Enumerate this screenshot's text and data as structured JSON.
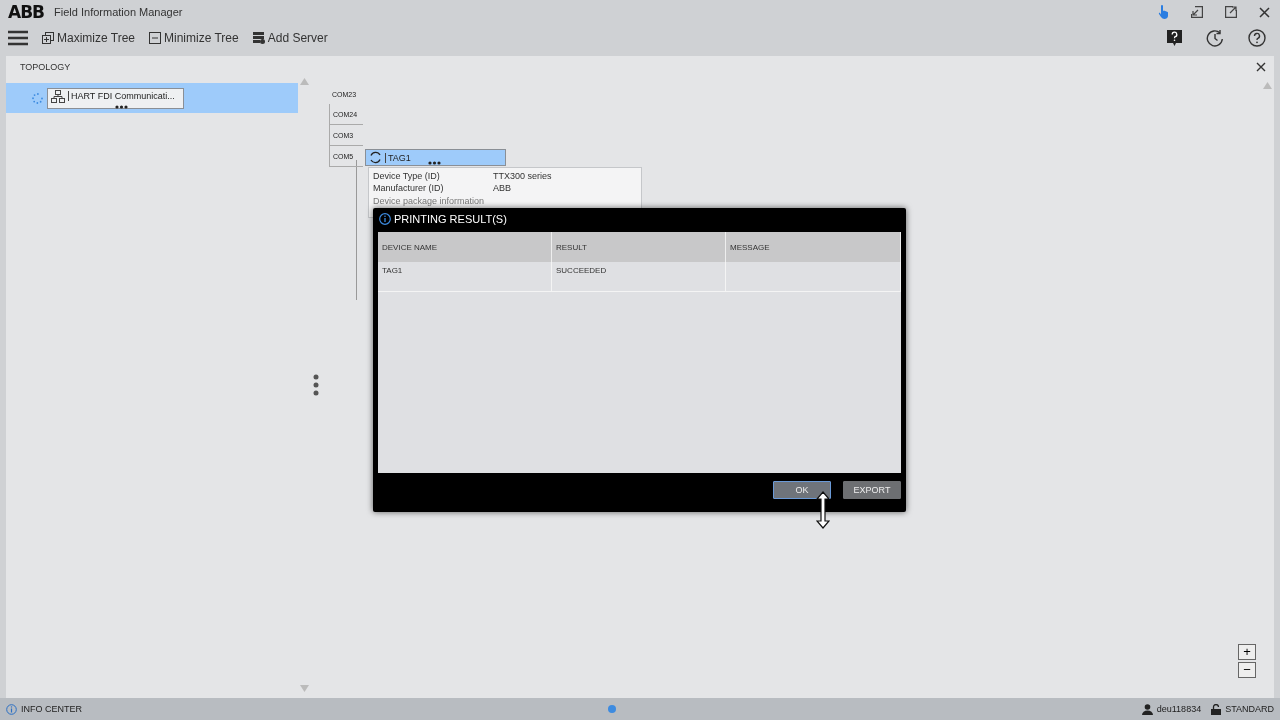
{
  "window": {
    "logo": "ABB",
    "title": "Field Information Manager"
  },
  "toolbar": [
    {
      "label": "Maximize Tree",
      "kind": "maximize"
    },
    {
      "label": "Minimize Tree",
      "kind": "minimize"
    },
    {
      "label": "Add Server",
      "kind": "server"
    }
  ],
  "panel": {
    "title": "TOPOLOGY"
  },
  "tree": [
    {
      "label": "HART FDI Communicati...",
      "selected": true
    }
  ],
  "ports": [
    "COM23",
    "COM24",
    "COM3",
    "COM5"
  ],
  "device": {
    "tag": "TAG1",
    "selected": true,
    "properties": [
      {
        "label": "Device Type (ID)",
        "value": "TTX300 series"
      },
      {
        "label": "Manufacturer (ID)",
        "value": "ABB"
      }
    ],
    "section": "Device package information"
  },
  "dialog": {
    "title": "PRINTING RESULT(S)",
    "columns": [
      "DEVICE NAME",
      "RESULT",
      "MESSAGE"
    ],
    "rows": [
      {
        "cells": [
          "TAG1",
          "SUCCEEDED"
        ]
      }
    ],
    "buttons": [
      {
        "label": "OK",
        "focused": true
      },
      {
        "label": "EXPORT",
        "focused": false
      }
    ]
  },
  "zoom": [
    "+",
    "−"
  ],
  "status_bar": {
    "info": "INFO CENTER",
    "user": "deu118834",
    "mode": "STANDARD"
  }
}
